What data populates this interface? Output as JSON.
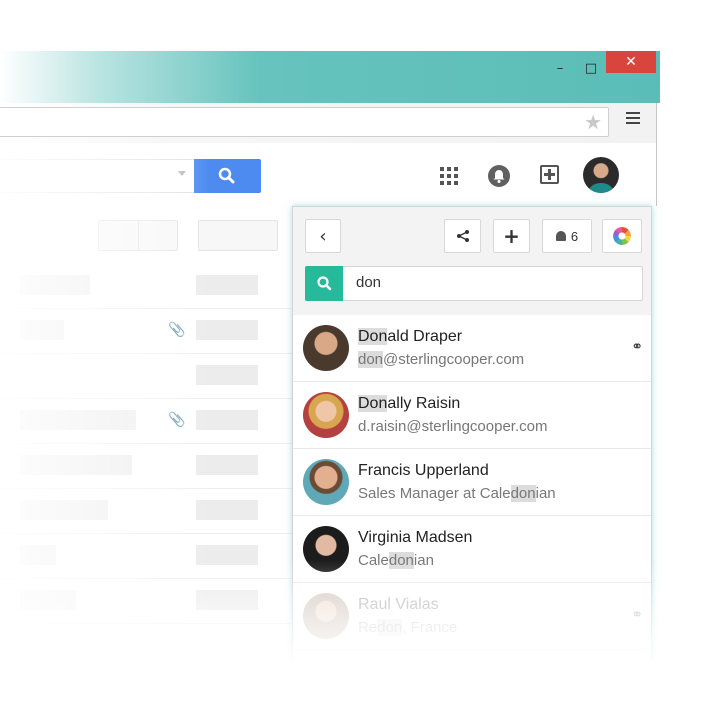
{
  "window": {
    "minimize_glyph": "–",
    "maximize_glyph": "□",
    "close_glyph": "✕",
    "accent": "#5bbdb7",
    "close_color": "#d9453c"
  },
  "browser": {
    "address_value": "",
    "bookmark_icon": "★"
  },
  "app_bar": {
    "search_value": "",
    "icons": [
      "search-icon",
      "apps-grid-icon",
      "notifications-icon",
      "compose-plus-icon",
      "profile-avatar"
    ]
  },
  "inbox": {
    "attachment_glyph": "📎"
  },
  "panel": {
    "back_glyph": "‹",
    "share_glyph": "≺",
    "add_glyph": "+",
    "notification_count": "6",
    "search_value": "don",
    "search_color": "#26b99a",
    "contacts": [
      {
        "name_hl": "Don",
        "name_rest": "ald Draper",
        "sub_pre": "",
        "sub_hl": "don",
        "sub_post": "@sterlingcooper.com",
        "linked": true
      },
      {
        "name_hl": "Don",
        "name_rest": "ally Raisin",
        "sub_pre": "d.raisin@sterlingcooper.com",
        "sub_hl": "",
        "sub_post": "",
        "linked": false
      },
      {
        "name_hl": "",
        "name_rest": "Francis Upperland",
        "sub_pre": "Sales Manager at Cale",
        "sub_hl": "don",
        "sub_post": "ian",
        "linked": false
      },
      {
        "name_hl": "",
        "name_rest": "Virginia Madsen",
        "sub_pre": "Cale",
        "sub_hl": "don",
        "sub_post": "ian",
        "linked": false
      },
      {
        "name_hl": "",
        "name_rest": "Raul Vialas",
        "sub_pre": "Re",
        "sub_hl": "don",
        "sub_post": ", France",
        "linked": true
      }
    ],
    "link_glyph": "⚭"
  }
}
